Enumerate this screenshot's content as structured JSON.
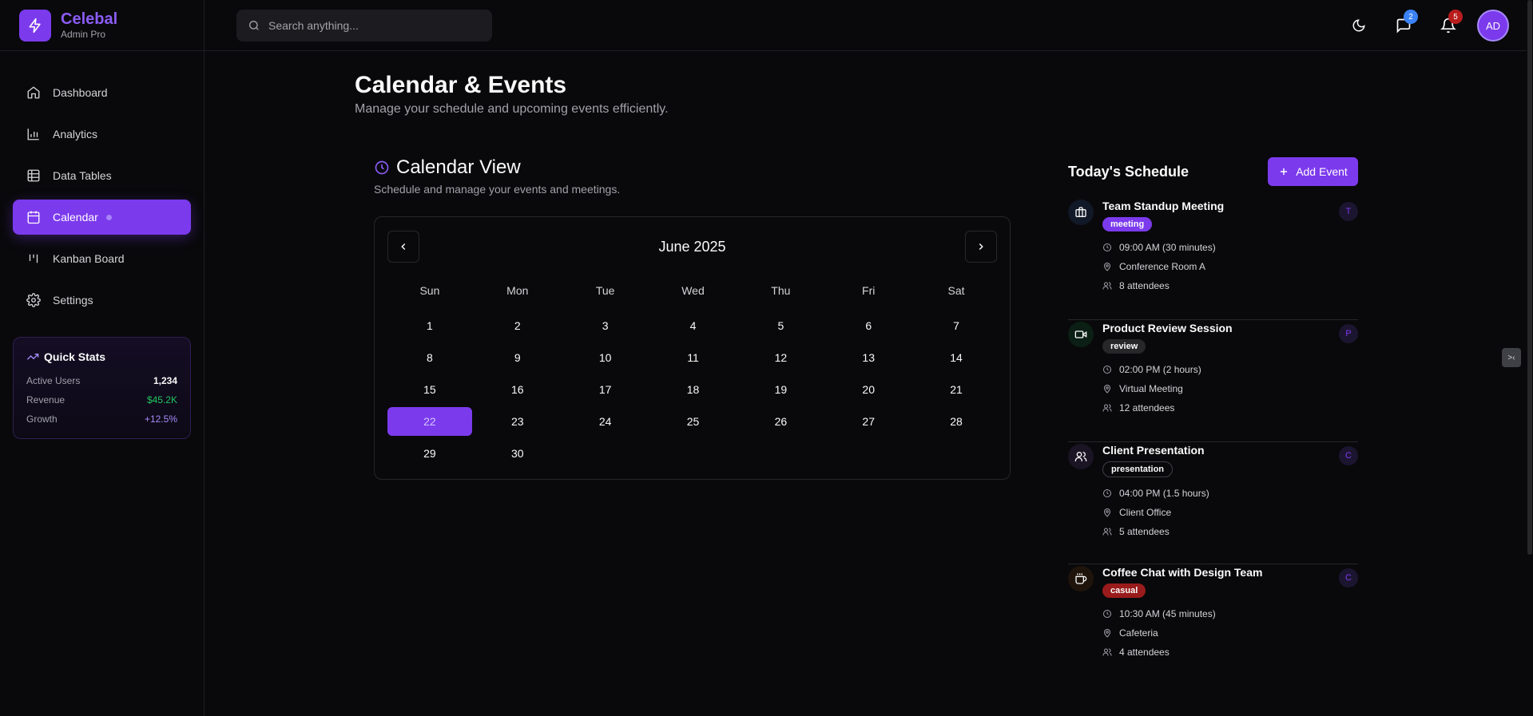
{
  "brand": {
    "name": "Celebal",
    "subtitle": "Admin Pro",
    "icon": "lightning-icon"
  },
  "sidebar": {
    "items": [
      {
        "label": "Dashboard",
        "icon": "home-icon",
        "active": false
      },
      {
        "label": "Analytics",
        "icon": "bar-chart-icon",
        "active": false
      },
      {
        "label": "Data Tables",
        "icon": "table-icon",
        "active": false
      },
      {
        "label": "Calendar",
        "icon": "calendar-icon",
        "active": true
      },
      {
        "label": "Kanban Board",
        "icon": "kanban-icon",
        "active": false
      },
      {
        "label": "Settings",
        "icon": "gear-icon",
        "active": false
      }
    ],
    "quick_stats": {
      "title": "Quick Stats",
      "rows": [
        {
          "label": "Active Users",
          "value": "1,234"
        },
        {
          "label": "Revenue",
          "value": "$45.2K"
        },
        {
          "label": "Growth",
          "value": "+12.5%"
        }
      ]
    }
  },
  "header": {
    "search_placeholder": "Search anything...",
    "messages_count": "2",
    "notifications_count": "5",
    "avatar_initials": "AD"
  },
  "main": {
    "title": "Calendar & Events",
    "subtitle": "Manage your schedule and upcoming events efficiently."
  },
  "calendar": {
    "title": "Calendar View",
    "subtitle": "Schedule and manage your events and meetings.",
    "month_label": "June 2025",
    "weekdays": [
      "Sun",
      "Mon",
      "Tue",
      "Wed",
      "Thu",
      "Fri",
      "Sat"
    ],
    "weeks": [
      [
        "1",
        "2",
        "3",
        "4",
        "5",
        "6",
        "7"
      ],
      [
        "8",
        "9",
        "10",
        "11",
        "12",
        "13",
        "14"
      ],
      [
        "15",
        "16",
        "17",
        "18",
        "19",
        "20",
        "21"
      ],
      [
        "22",
        "23",
        "24",
        "25",
        "26",
        "27",
        "28"
      ],
      [
        "29",
        "30",
        "",
        "",
        "",
        "",
        ""
      ]
    ],
    "selected_day": "22"
  },
  "schedule": {
    "title": "Today's Schedule",
    "add_label": "Add Event",
    "events": [
      {
        "title": "Team Standup Meeting",
        "tag": "meeting",
        "time": "09:00 AM (30 minutes)",
        "location": "Conference Room A",
        "attendees": "8 attendees",
        "avatar": "T",
        "icon": "briefcase-icon",
        "tag_color": "#7c3aed",
        "icon_bg": "#111827"
      },
      {
        "title": "Product Review Session",
        "tag": "review",
        "time": "02:00 PM (2 hours)",
        "location": "Virtual Meeting",
        "attendees": "12 attendees",
        "avatar": "P",
        "icon": "video-icon",
        "tag_color": "#27272a",
        "icon_bg": "#0b1f14"
      },
      {
        "title": "Client Presentation",
        "tag": "presentation",
        "time": "04:00 PM (1.5 hours)",
        "location": "Client Office",
        "attendees": "5 attendees",
        "avatar": "C",
        "icon": "users-icon",
        "tag_color": "#09090b",
        "icon_bg": "#1a1425"
      },
      {
        "title": "Coffee Chat with Design Team",
        "tag": "casual",
        "time": "10:30 AM (45 minutes)",
        "location": "Cafeteria",
        "attendees": "4 attendees",
        "avatar": "C",
        "icon": "coffee-icon",
        "tag_color": "#991b1b",
        "icon_bg": "#1f140b"
      }
    ]
  },
  "colors": {
    "accent": "#7c3aed",
    "background": "#09090b",
    "border": "#27272a"
  }
}
